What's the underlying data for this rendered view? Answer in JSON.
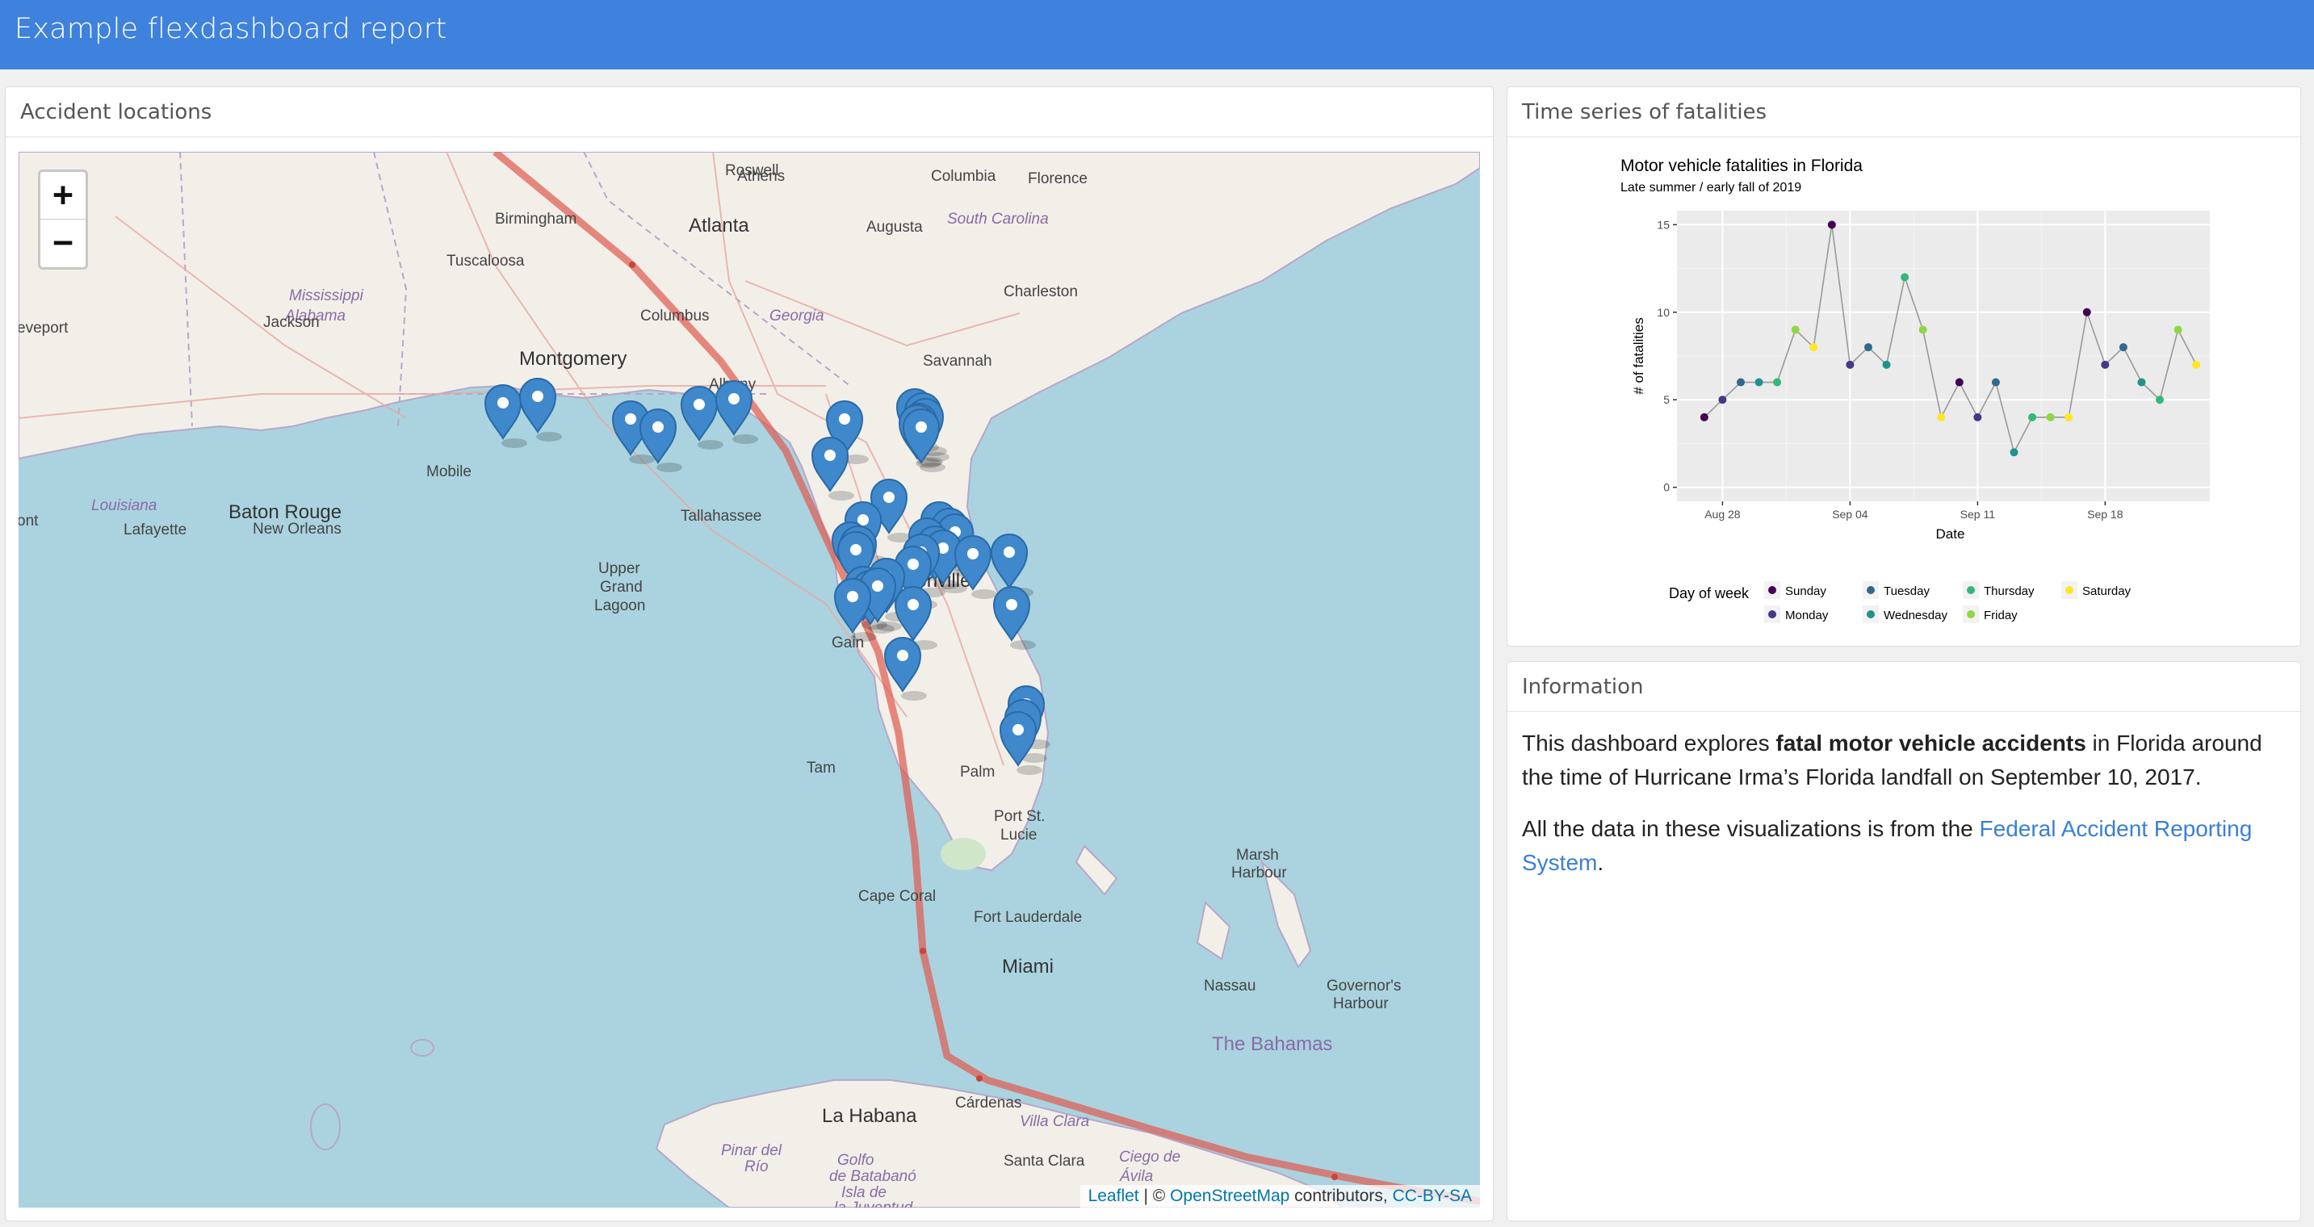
{
  "navbar": {
    "title": "Example flexdashboard report"
  },
  "map_panel": {
    "title": "Accident locations",
    "zoom_in": "+",
    "zoom_out": "−",
    "attribution": {
      "leaflet": "Leaflet",
      "sep": " | © ",
      "osm": "OpenStreetMap",
      "contrib": " contributors, ",
      "license": "CC-BY-SA"
    },
    "place_labels": [
      {
        "text": "Roswell",
        "cls": "town"
      },
      {
        "text": "Athens",
        "cls": "town"
      },
      {
        "text": "Columbia",
        "cls": "town"
      },
      {
        "text": "Florence",
        "cls": "town"
      },
      {
        "text": "Birmingham",
        "cls": "town"
      },
      {
        "text": "Atlanta",
        "cls": "city"
      },
      {
        "text": "Augusta",
        "cls": "town"
      },
      {
        "text": "South Carolina",
        "cls": "state"
      },
      {
        "text": "Tuscaloosa",
        "cls": "town"
      },
      {
        "text": "Mississippi",
        "cls": "state"
      },
      {
        "text": "Alabama",
        "cls": "state"
      },
      {
        "text": "Columbus",
        "cls": "town"
      },
      {
        "text": "Georgia",
        "cls": "state"
      },
      {
        "text": "Charleston",
        "cls": "town"
      },
      {
        "text": "eveport",
        "cls": "town"
      },
      {
        "text": "Jackson",
        "cls": "town"
      },
      {
        "text": "Montgomery",
        "cls": "city"
      },
      {
        "text": "Savannah",
        "cls": "town"
      },
      {
        "text": "Albany",
        "cls": "town"
      },
      {
        "text": "Mobile",
        "cls": "town"
      },
      {
        "text": "Louisiana",
        "cls": "state"
      },
      {
        "text": "Baton Rouge",
        "cls": "city"
      },
      {
        "text": "Tallahassee",
        "cls": "town"
      },
      {
        "text": "Jacksonville",
        "cls": "city"
      },
      {
        "text": "ont",
        "cls": "town"
      },
      {
        "text": "Lafayette",
        "cls": "town"
      },
      {
        "text": "New Orleans",
        "cls": "town"
      },
      {
        "text": "Upper",
        "cls": "town"
      },
      {
        "text": "Grand",
        "cls": "town"
      },
      {
        "text": "Lagoon",
        "cls": "town"
      },
      {
        "text": "Gain",
        "cls": "town"
      },
      {
        "text": "Tam",
        "cls": "town"
      },
      {
        "text": "Palm",
        "cls": "town"
      },
      {
        "text": "Port St.",
        "cls": "town"
      },
      {
        "text": "Lucie",
        "cls": "town"
      },
      {
        "text": "Marsh",
        "cls": "town"
      },
      {
        "text": "Harbour",
        "cls": "town"
      },
      {
        "text": "Cape Coral",
        "cls": "town"
      },
      {
        "text": "Fort Lauderdale",
        "cls": "town"
      },
      {
        "text": "Miami",
        "cls": "city"
      },
      {
        "text": "Nassau",
        "cls": "town"
      },
      {
        "text": "Governor's",
        "cls": "town"
      },
      {
        "text": "Harbour",
        "cls": "town"
      },
      {
        "text": "The Bahamas",
        "cls": "country"
      },
      {
        "text": "La Habana",
        "cls": "city"
      },
      {
        "text": "Cárdenas",
        "cls": "town"
      },
      {
        "text": "Villa Clara",
        "cls": "state"
      },
      {
        "text": "Pinar del",
        "cls": "state"
      },
      {
        "text": "Río",
        "cls": "state"
      },
      {
        "text": "Santa Clara",
        "cls": "town"
      },
      {
        "text": "Ciego de",
        "cls": "state"
      },
      {
        "text": "Ávila",
        "cls": "state"
      },
      {
        "text": "Golfo",
        "cls": "state"
      },
      {
        "text": "de Batabanó",
        "cls": "state"
      },
      {
        "text": "Isla de",
        "cls": "state"
      },
      {
        "text": "la Juventud",
        "cls": "state"
      }
    ],
    "marker_count": 40
  },
  "chart_panel": {
    "title": "Time series of fatalities"
  },
  "chart_data": {
    "type": "line",
    "title": "Motor vehicle fatalities in Florida",
    "subtitle": "Late summer / early fall of 2019",
    "xlabel": "Date",
    "ylabel": "# of fatalities",
    "x_ticks": [
      "Aug 28",
      "Sep 04",
      "Sep 11",
      "Sep 18"
    ],
    "y_ticks": [
      0,
      5,
      10,
      15
    ],
    "ylim": [
      -0.8,
      15.8
    ],
    "x_range_days": [
      -1.5,
      28.5
    ],
    "tick_days": [
      1,
      8,
      15,
      22
    ],
    "day_offsets_from": "Aug 27",
    "points": [
      {
        "date": "Aug 27",
        "value": 4,
        "dow": "Sunday"
      },
      {
        "date": "Aug 28",
        "value": 5,
        "dow": "Monday"
      },
      {
        "date": "Aug 29",
        "value": 6,
        "dow": "Tuesday"
      },
      {
        "date": "Aug 30",
        "value": 6,
        "dow": "Wednesday"
      },
      {
        "date": "Aug 31",
        "value": 6,
        "dow": "Thursday"
      },
      {
        "date": "Sep 01",
        "value": 9,
        "dow": "Friday"
      },
      {
        "date": "Sep 02",
        "value": 8,
        "dow": "Saturday"
      },
      {
        "date": "Sep 03",
        "value": 15,
        "dow": "Sunday"
      },
      {
        "date": "Sep 04",
        "value": 7,
        "dow": "Monday"
      },
      {
        "date": "Sep 05",
        "value": 8,
        "dow": "Tuesday"
      },
      {
        "date": "Sep 06",
        "value": 7,
        "dow": "Wednesday"
      },
      {
        "date": "Sep 07",
        "value": 12,
        "dow": "Thursday"
      },
      {
        "date": "Sep 08",
        "value": 9,
        "dow": "Friday"
      },
      {
        "date": "Sep 09",
        "value": 4,
        "dow": "Saturday"
      },
      {
        "date": "Sep 10",
        "value": 6,
        "dow": "Sunday"
      },
      {
        "date": "Sep 11",
        "value": 4,
        "dow": "Monday"
      },
      {
        "date": "Sep 12",
        "value": 6,
        "dow": "Tuesday"
      },
      {
        "date": "Sep 13",
        "value": 2,
        "dow": "Wednesday"
      },
      {
        "date": "Sep 14",
        "value": 4,
        "dow": "Thursday"
      },
      {
        "date": "Sep 15",
        "value": 4,
        "dow": "Friday"
      },
      {
        "date": "Sep 16",
        "value": 4,
        "dow": "Saturday"
      },
      {
        "date": "Sep 17",
        "value": 10,
        "dow": "Sunday"
      },
      {
        "date": "Sep 18",
        "value": 7,
        "dow": "Monday"
      },
      {
        "date": "Sep 19",
        "value": 8,
        "dow": "Tuesday"
      },
      {
        "date": "Sep 20",
        "value": 6,
        "dow": "Wednesday"
      },
      {
        "date": "Sep 21",
        "value": 5,
        "dow": "Thursday"
      },
      {
        "date": "Sep 22",
        "value": 9,
        "dow": "Friday"
      },
      {
        "date": "Sep 23",
        "value": 7,
        "dow": "Saturday"
      }
    ],
    "legend": {
      "title": "Day of week",
      "entries": [
        {
          "label": "Sunday",
          "color": "#440154"
        },
        {
          "label": "Monday",
          "color": "#443983"
        },
        {
          "label": "Tuesday",
          "color": "#31688e"
        },
        {
          "label": "Wednesday",
          "color": "#21918c"
        },
        {
          "label": "Thursday",
          "color": "#35b779"
        },
        {
          "label": "Friday",
          "color": "#90d743"
        },
        {
          "label": "Saturday",
          "color": "#fde725"
        }
      ]
    },
    "colors": {
      "panel": "#ebebeb",
      "line": "#999999"
    }
  },
  "info_panel": {
    "title": "Information",
    "p1_a": "This dashboard explores ",
    "p1_b": "fatal motor vehicle accidents",
    "p1_c": " in Florida around the time of Hurricane Irma’s Florida landfall on September 10, 2017.",
    "p2_a": "All the data in these visualizations is from the ",
    "p2_link": "Federal Accident Reporting System",
    "p2_c": "."
  }
}
